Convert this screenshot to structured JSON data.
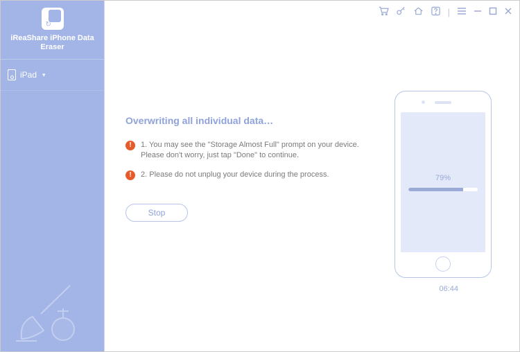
{
  "app": {
    "title": "iReaShare iPhone Data Eraser"
  },
  "sidebar": {
    "device_label": "iPad"
  },
  "titlebar": {
    "icons": {
      "cart": "cart-icon",
      "key": "key-icon",
      "home": "home-icon",
      "help": "help-icon",
      "menu": "menu-icon",
      "minimize": "minimize-button",
      "maximize": "maximize-button",
      "close": "close-button"
    }
  },
  "main": {
    "heading": "Overwriting all individual data…",
    "note1": "1. You may see the \"Storage Almost Full\" prompt on your device. Please don't worry, just tap \"Done\" to continue.",
    "note2": "2. Please do not unplug your device during the process.",
    "stop_label": "Stop"
  },
  "progress": {
    "percent_label": "79%",
    "percent_value": 79,
    "elapsed": "06:44"
  }
}
